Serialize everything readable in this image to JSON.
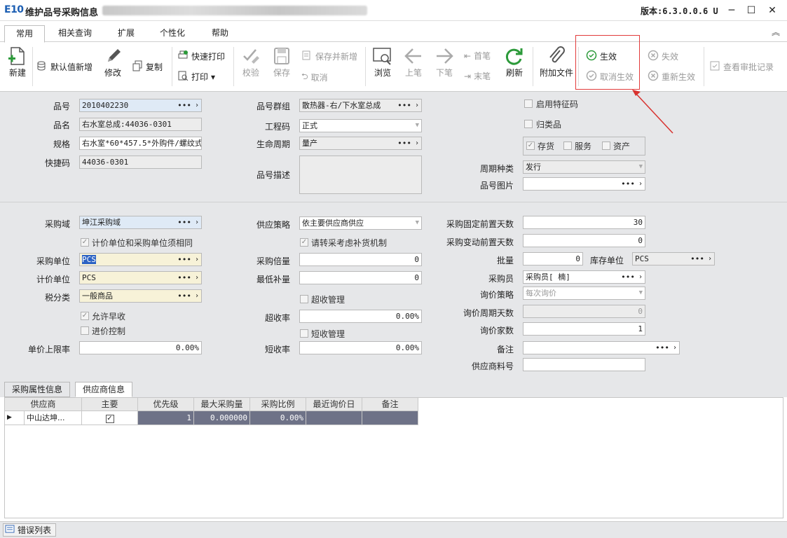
{
  "window": {
    "logo": "E10",
    "title": "维护品号采购信息",
    "version": "版本:6.3.0.0.6 U",
    "min_icon": "─",
    "max_icon": "☐",
    "close_icon": "✕"
  },
  "menu_tabs": [
    "常用",
    "相关查询",
    "扩展",
    "个性化",
    "帮助"
  ],
  "toolbar": {
    "new": "新建",
    "default_new": "默认值新增",
    "edit": "修改",
    "copy": "复制",
    "quick_print": "快速打印",
    "print": "打印",
    "check": "校验",
    "save": "保存",
    "save_and_new": "保存并新增",
    "cancel": "取消",
    "browse": "浏览",
    "prev": "上笔",
    "next": "下笔",
    "first": "首笔",
    "last": "末笔",
    "refresh": "刷新",
    "attach": "附加文件",
    "effective": "生效",
    "cancel_effective": "取消生效",
    "invalid": "失效",
    "re_effective": "重新生效",
    "view_approval": "查看审批记录"
  },
  "form": {
    "item_no_label": "品号",
    "item_no": "2010402230",
    "item_name_label": "品名",
    "item_name": "右水室总成:44036-0301",
    "spec_label": "规格",
    "spec": "右水室*60*457.5*外购件/螺纹式",
    "quick_code_label": "快捷码",
    "quick_code": "44036-0301",
    "item_group_label": "品号群组",
    "item_group": "散热器-右/下水室总成",
    "eng_code_label": "工程码",
    "eng_code": "正式",
    "life_cycle_label": "生命周期",
    "life_cycle": "量产",
    "desc_label": "品号描述",
    "enable_feature": "启用特征码",
    "classified": "归类品",
    "stock": "存货",
    "service": "服务",
    "asset": "资产",
    "cycle_type_label": "周期种类",
    "cycle_type": "发行",
    "item_image_label": "品号图片",
    "purchase_domain_label": "采购域",
    "purchase_domain": "坤江采购域",
    "same_unit": "计价单位和采购单位须相同",
    "purchase_unit_label": "采购单位",
    "purchase_unit": "PCS",
    "price_unit_label": "计价单位",
    "price_unit": "PCS",
    "tax_class_label": "税分类",
    "tax_class": "一般商品",
    "allow_early": "允许早收",
    "price_control": "进价控制",
    "price_upper_label": "单价上限率",
    "price_upper": "0.00%",
    "supply_strategy_label": "供应策略",
    "supply_strategy": "依主要供应商供应",
    "replenish": "请转采考虑补货机制",
    "purchase_multiple_label": "采购倍量",
    "purchase_multiple": "0",
    "min_replenish_label": "最低补量",
    "min_replenish": "0",
    "over_receive": "超收管理",
    "over_rate_label": "超收率",
    "over_rate": "0.00%",
    "short_receive": "短收管理",
    "short_rate_label": "短收率",
    "short_rate": "0.00%",
    "fixed_lead_label": "采购固定前置天数",
    "fixed_lead": "30",
    "var_lead_label": "采购变动前置天数",
    "var_lead": "0",
    "batch_label": "批量",
    "batch": "0",
    "stock_unit_label": "库存单位",
    "stock_unit": "PCS",
    "buyer_label": "采购员",
    "buyer": "采购员[    楠]",
    "inquiry_strategy_label": "询价策略",
    "inquiry_strategy": "每次询价",
    "inquiry_cycle_label": "询价周期天数",
    "inquiry_cycle": "0",
    "inquiry_count_label": "询价家数",
    "inquiry_count": "1",
    "remark_label": "备注",
    "supplier_part_label": "供应商料号"
  },
  "bottom_tabs": [
    "采购属性信息",
    "供应商信息"
  ],
  "grid": {
    "headers": [
      "供应商",
      "主要",
      "优先级",
      "最大采购量",
      "采购比例",
      "最近询价日",
      "备注"
    ],
    "rows": [
      {
        "supplier": "中山达坤...",
        "main": "✓",
        "priority": "1",
        "max_qty": "0.000000",
        "ratio": "0.00%",
        "last_inquiry": "",
        "remark": ""
      }
    ]
  },
  "status": {
    "error_list": "错误列表"
  }
}
